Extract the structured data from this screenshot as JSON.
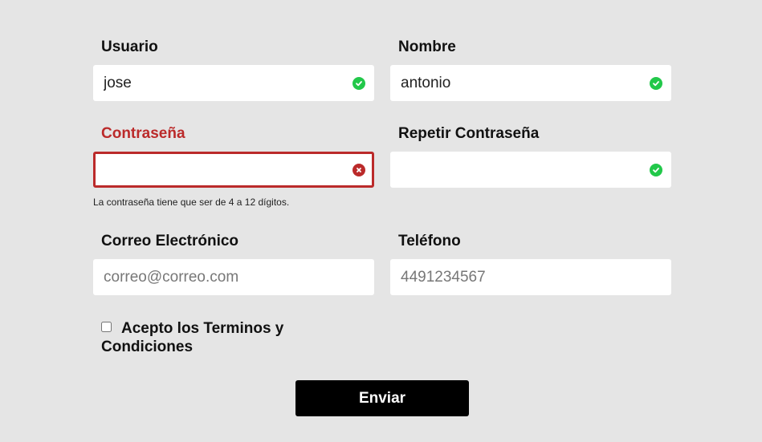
{
  "form": {
    "usuario": {
      "label": "Usuario",
      "value": "jose",
      "placeholder": "",
      "status": "valid"
    },
    "nombre": {
      "label": "Nombre",
      "value": "antonio",
      "placeholder": "",
      "status": "valid"
    },
    "password": {
      "label": "Contraseña",
      "value": "",
      "placeholder": "",
      "status": "error",
      "error_message": "La contraseña tiene que ser de 4 a 12 dígitos."
    },
    "password_repeat": {
      "label": "Repetir Contraseña",
      "value": "",
      "placeholder": "",
      "status": "valid"
    },
    "email": {
      "label": "Correo Electrónico",
      "value": "",
      "placeholder": "correo@correo.com"
    },
    "phone": {
      "label": "Teléfono",
      "value": "",
      "placeholder": "4491234567"
    },
    "terms": {
      "label": "Acepto los Terminos y Condiciones",
      "checked": false
    },
    "submit_label": "Enviar"
  },
  "colors": {
    "background": "#e5e5e5",
    "error": "#bb2a2a",
    "valid": "#22c84a",
    "button": "#000000"
  },
  "icons": {
    "valid": "check-circle-icon",
    "error": "x-circle-icon"
  }
}
